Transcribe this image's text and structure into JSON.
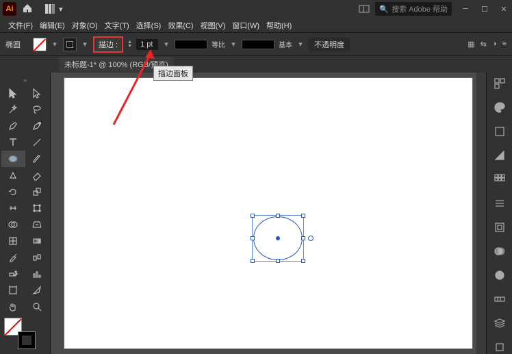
{
  "titlebar": {
    "logo_text": "Ai",
    "search_placeholder": "搜索 Adobe 帮助"
  },
  "menubar": {
    "file": "文件(F)",
    "edit": "编辑(E)",
    "object": "对象(O)",
    "type": "文字(T)",
    "select": "选择(S)",
    "effect": "效果(C)",
    "view": "视图(V)",
    "window": "窗口(W)",
    "help": "帮助(H)"
  },
  "controlbar": {
    "tool_name": "椭圆",
    "stroke_label": "描边 :",
    "stroke_weight": "1 pt",
    "profile_uniform": "等比",
    "brush_basic": "基本",
    "opacity_label": "不透明度"
  },
  "tabbar": {
    "doc_title": "未标题-1* @ 100% (RGB/预览)"
  },
  "tooltip": {
    "stroke_panel": "描边面板"
  },
  "right_panel_icons": [
    "properties",
    "color",
    "libraries",
    "swatches",
    "brushes",
    "symbols",
    "stroke",
    "gradient",
    "transparency",
    "appearance",
    "graphic-styles",
    "layers"
  ]
}
